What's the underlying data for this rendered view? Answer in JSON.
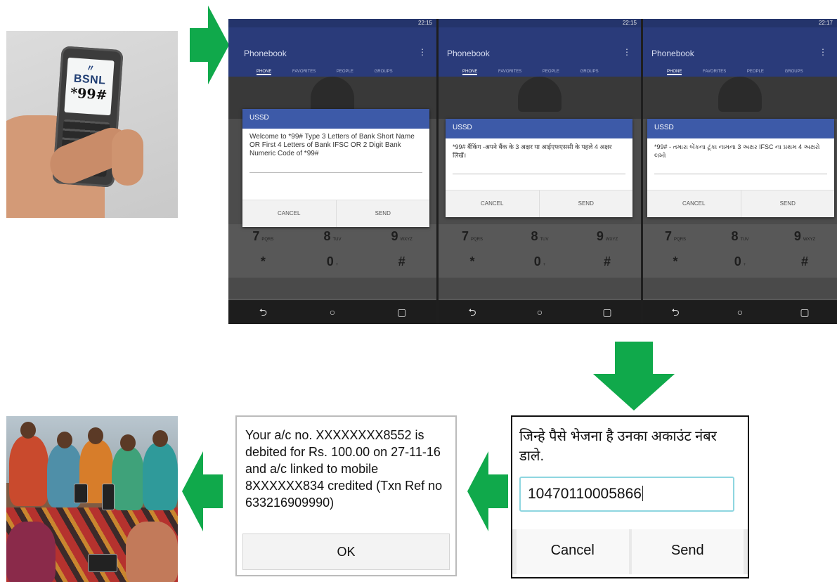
{
  "bsnl_phone": {
    "brand": "BSNL",
    "code": "*99#"
  },
  "phone_screens": {
    "status_times": [
      "22:15",
      "22:15",
      "22:17"
    ],
    "app_title": "Phonebook",
    "tabs": [
      "PHONE",
      "FAVORITES",
      "PEOPLE",
      "GROUPS"
    ],
    "ussd_title": "USSD",
    "messages": [
      "Welcome to *99# Type 3 Letters of Bank Short Name OR First 4 Letters of Bank IFSC OR 2 Digit Bank Numeric Code of *99#",
      "*99# बैंकिंग -अपने बैंक के 3 अक्षर या आईएफएससी के पहले 4 अक्षर लिखें।",
      "*99# - તમારા બેંકના ટૂંકા નામના 3 અક્ષર IFSC ના પ્રથમ 4 અક્ષરો લખો"
    ],
    "cancel_label": "CANCEL",
    "send_label": "SEND",
    "keypad_rows": [
      [
        {
          "d": "7",
          "l": "PQRS"
        },
        {
          "d": "8",
          "l": "TUV"
        },
        {
          "d": "9",
          "l": "WXYZ"
        }
      ],
      [
        {
          "d": "*",
          "l": ""
        },
        {
          "d": "0",
          "l": "+"
        },
        {
          "d": "#",
          "l": ""
        }
      ]
    ]
  },
  "account_prompt": {
    "prompt": "जिन्हे पैसे भेजना है उनका अकाउंट नंबर डाले.",
    "input_value": "10470110005866",
    "cancel_label": "Cancel",
    "send_label": "Send"
  },
  "debit_message": {
    "text": "Your a/c no. XXXXXXXX8552 is debited for Rs. 100.00 on 27-11-16 and a/c linked to mobile 8XXXXXX834 credited (Txn Ref no 633216909990)",
    "ok_label": "OK"
  },
  "colors": {
    "arrow": "#10a94b",
    "ussd_header": "#3d5aa8",
    "app_bar": "#2a3b7a",
    "input_border": "#8ed6e0"
  }
}
